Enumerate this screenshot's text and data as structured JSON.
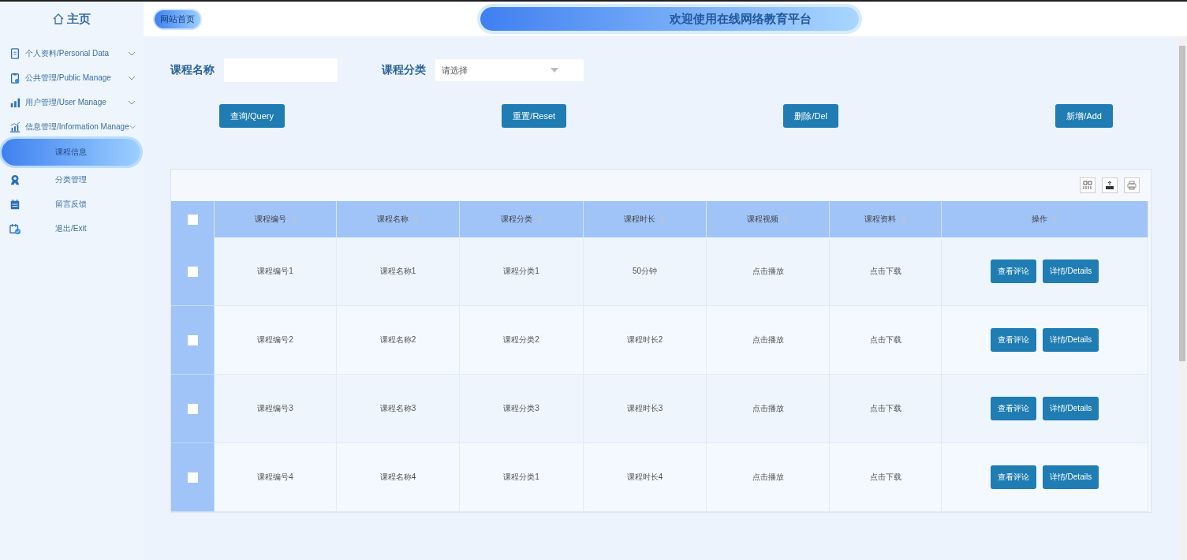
{
  "sidebar": {
    "title": "主页",
    "menu": [
      {
        "label": "个人资料/Personal Data",
        "kind": "group"
      },
      {
        "label": "公共管理/Public Manage",
        "kind": "group"
      },
      {
        "label": "用户管理/User Manage",
        "kind": "group"
      },
      {
        "label": "信息管理/Information Manage",
        "kind": "group",
        "children": [
          {
            "label": "课程信息",
            "selected": true
          }
        ]
      },
      {
        "label": "分类管理",
        "kind": "link",
        "selected": false
      },
      {
        "label": "留言反馈",
        "kind": "link",
        "selected": false
      },
      {
        "label": "退出/Exit",
        "kind": "link",
        "selected": false
      }
    ]
  },
  "header": {
    "home_link": "网站首页",
    "banner": "欢迎使用在线网络教育平台"
  },
  "search": {
    "fields": [
      {
        "label": "课程名称",
        "kind": "text"
      },
      {
        "label": "课程分类",
        "kind": "select",
        "placeholder": "请选择"
      }
    ],
    "buttons": [
      "查询/Query",
      "重置/Reset",
      "删除/Del",
      "新增/Add"
    ]
  },
  "table": {
    "select_all_checked": false,
    "columns": [
      "课程编号",
      "课程名称",
      "课程分类",
      "课程时长",
      "课程视频",
      "课程资料",
      "操作"
    ],
    "rows": [
      {
        "checked": false,
        "cells": [
          "课程编号1",
          "课程名称1",
          "课程分类1",
          "50分钟",
          "点击播放",
          "点击下载"
        ],
        "actions": [
          "查看评论",
          "详情/Details"
        ]
      },
      {
        "checked": false,
        "cells": [
          "课程编号2",
          "课程名称2",
          "课程分类2",
          "课程时长2",
          "点击播放",
          "点击下载"
        ],
        "actions": [
          "查看评论",
          "详情/Details"
        ]
      },
      {
        "checked": false,
        "cells": [
          "课程编号3",
          "课程名称3",
          "课程分类3",
          "课程时长3",
          "点击播放",
          "点击下载"
        ],
        "actions": [
          "查看评论",
          "详情/Details"
        ]
      },
      {
        "checked": false,
        "cells": [
          "课程编号4",
          "课程名称4",
          "课程分类1",
          "课程时长4",
          "点击播放",
          "点击下载"
        ],
        "actions": [
          "查看评论",
          "详情/Details"
        ]
      }
    ]
  }
}
